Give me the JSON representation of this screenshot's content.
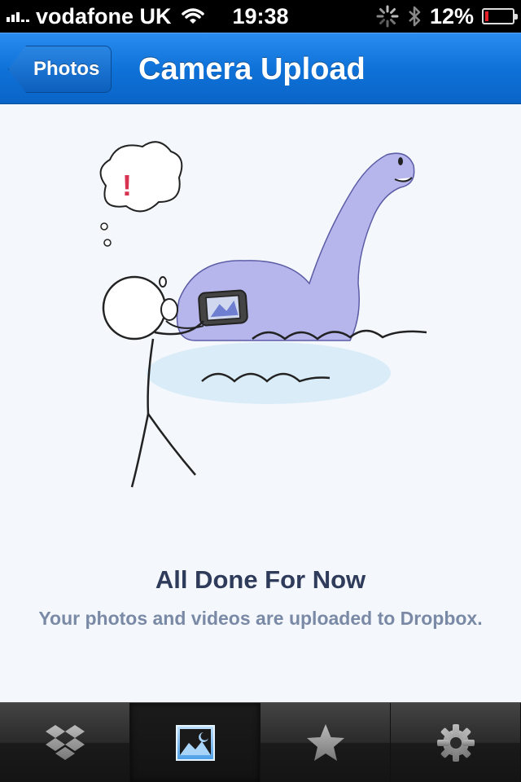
{
  "status_bar": {
    "carrier": "vodafone UK",
    "time": "19:38",
    "battery": "12%",
    "battery_level": 0.12,
    "battery_color": "#e4202a",
    "icons": [
      "signal-icon",
      "wifi-icon",
      "activity-spinner-icon",
      "bluetooth-icon",
      "battery-icon"
    ]
  },
  "nav_bar": {
    "back_label": "Photos",
    "title": "Camera Upload",
    "color": "#0f72d8"
  },
  "content": {
    "illustration": "stick figure photographing a lake monster with a phone",
    "title": "All Done For Now",
    "subtitle": "Your photos and videos are uploaded to Dropbox."
  },
  "tab_bar": {
    "tabs": [
      {
        "icon": "dropbox-icon",
        "active": false
      },
      {
        "icon": "photos-icon",
        "active": true
      },
      {
        "icon": "favorites-star-icon",
        "active": false
      },
      {
        "icon": "settings-gear-icon",
        "active": false
      }
    ]
  }
}
